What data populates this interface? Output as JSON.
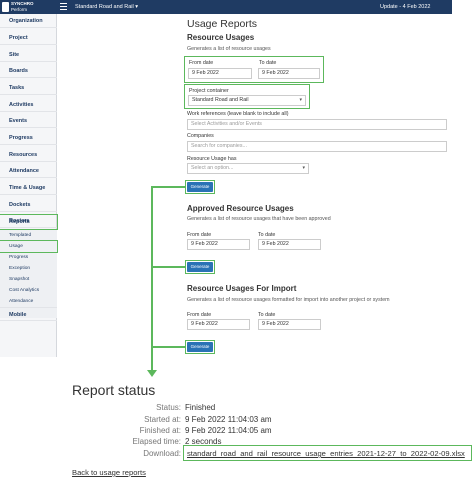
{
  "topbar": {
    "brand_line1": "SYNCHRO",
    "brand_line2": "Perform",
    "project": "Standard Road and Rail ▾",
    "update": "Update - 4 Feb 2022"
  },
  "sidebar": {
    "items": [
      "Organization",
      "Project",
      "Site",
      "Boards",
      "Tasks",
      "Activities",
      "Events",
      "Progress",
      "Resources",
      "Attendance",
      "Time & Usage",
      "Dockets",
      "Rosters",
      "Reports",
      "Mobile"
    ],
    "sub_items": [
      "Templated",
      "Usage",
      "Progress",
      "Exception",
      "Snapshot",
      "Cost Analytics",
      "Attendance"
    ]
  },
  "main": {
    "title": "Usage Reports",
    "resource_usages": {
      "heading": "Resource Usages",
      "description": "Generates a list of resource usages",
      "from_label": "From date",
      "from_value": "9 Feb 2022",
      "to_label": "To date",
      "to_value": "9 Feb 2022",
      "container_label": "Project container",
      "container_value": "Standard Road and Rail",
      "workrefs_label": "Work references (leave blank to include all)",
      "workrefs_placeholder": "Select Activities and/or Events",
      "companies_label": "Companies",
      "companies_placeholder": "Search for companies...",
      "has_label": "Resource Usage has",
      "has_placeholder": "Select an option...",
      "generate": "Generate"
    },
    "approved": {
      "heading": "Approved Resource Usages",
      "description": "Generates a list of resource usages that have been approved",
      "from_label": "From date",
      "from_value": "9 Feb 2022",
      "to_label": "To date",
      "to_value": "9 Feb 2022",
      "generate": "Generate"
    },
    "import": {
      "heading": "Resource Usages For Import",
      "description": "Generates a list of resource usages formatted for import into another project or system",
      "from_label": "From date",
      "from_value": "9 Feb 2022",
      "to_label": "To date",
      "to_value": "9 Feb 2022",
      "generate": "Generate"
    }
  },
  "report_status": {
    "title": "Report status",
    "status_label": "Status:",
    "status_value": "Finished",
    "started_label": "Started at:",
    "started_value": "9 Feb 2022 11:04:03 am",
    "finished_label": "Finished at:",
    "finished_value": "9 Feb 2022 11:04:05 am",
    "elapsed_label": "Elapsed time:",
    "elapsed_value": "2 seconds",
    "download_label": "Download:",
    "download_file": "standard_road_and_rail_resource_usage_entries_2021-12-27_to_2022-02-09.xlsx",
    "back_link": "Back to usage reports"
  },
  "colors": {
    "topbar": "#1f3b63",
    "highlight": "#5cb85c",
    "button": "#2a72b5"
  },
  "icons": [
    "synchro-logo-icon",
    "hamburger-menu-icon",
    "chevron-down-icon"
  ]
}
